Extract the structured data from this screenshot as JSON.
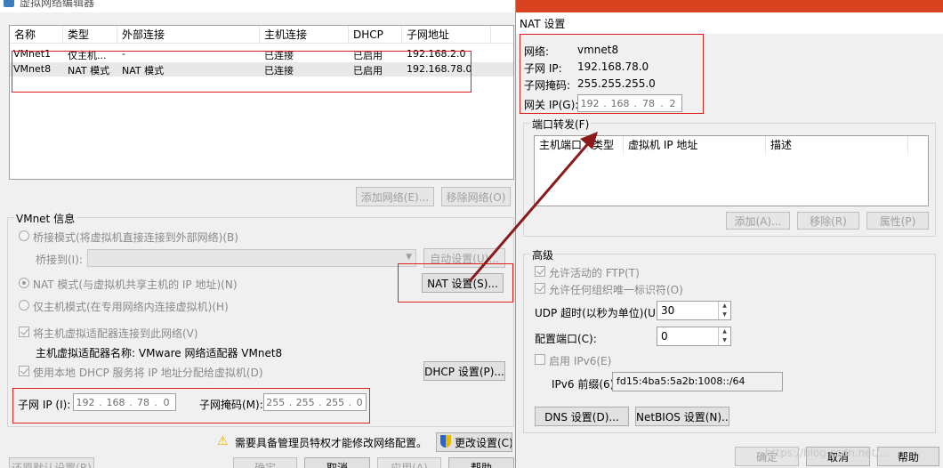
{
  "left": {
    "title": "虚拟网络编辑器",
    "columns": [
      "名称",
      "类型",
      "外部连接",
      "主机连接",
      "DHCP",
      "子网地址"
    ],
    "rows": [
      {
        "name": "VMnet1",
        "type": "仅主机...",
        "ext": "-",
        "host": "已连接",
        "dhcp": "已启用",
        "subnet": "192.168.2.0"
      },
      {
        "name": "VMnet8",
        "type": "NAT 模式",
        "ext": "NAT 模式",
        "host": "已连接",
        "dhcp": "已启用",
        "subnet": "192.168.78.0"
      }
    ],
    "add_network": "添加网络(E)...",
    "remove_network": "移除网络(O)",
    "info_title": "VMnet 信息",
    "bridge_mode": "桥接模式(将虚拟机直接连接到外部网络)(B)",
    "bridge_to": "桥接到(I):",
    "auto_settings": "自动设置(U)...",
    "nat_mode": "NAT 模式(与虚拟机共享主机的 IP 地址)(N)",
    "nat_settings": "NAT 设置(S)...",
    "host_only": "仅主机模式(在专用网络内连接虚拟机)(H)",
    "connect_adapter": "将主机虚拟适配器连接到此网络(V)",
    "adapter_name": "主机虚拟适配器名称: VMware 网络适配器 VMnet8",
    "use_dhcp": "使用本地 DHCP 服务将 IP 地址分配给虚拟机(D)",
    "dhcp_settings": "DHCP 设置(P)...",
    "subnet_ip_label": "子网 IP (I):",
    "subnet_ip": [
      "192",
      "168",
      "78",
      "0"
    ],
    "subnet_mask_label": "子网掩码(M):",
    "subnet_mask": [
      "255",
      "255",
      "255",
      "0"
    ],
    "admin_warning": "需要具备管理员特权才能修改网络配置。",
    "change_settings": "更改设置(C)",
    "restore_defaults": "还原默认设置(R)",
    "ok": "确定",
    "cancel": "取消",
    "apply": "应用(A)",
    "help": "帮助"
  },
  "right": {
    "title": "NAT 设置",
    "network_label": "网络:",
    "network_value": "vmnet8",
    "subnet_ip_label": "子网 IP:",
    "subnet_ip_value": "192.168.78.0",
    "subnet_mask_label": "子网掩码:",
    "subnet_mask_value": "255.255.255.0",
    "gateway_label": "网关 IP(G):",
    "gateway_ip": [
      "192",
      "168",
      "78",
      "2"
    ],
    "port_forward": "端口转发(F)",
    "pf_columns": [
      "主机端口",
      "类型",
      "虚拟机 IP 地址",
      "描述"
    ],
    "pf_add": "添加(A)...",
    "pf_remove": "移除(R)",
    "pf_props": "属性(P)",
    "advanced": "高级",
    "allow_ftp": "允许活动的 FTP(T)",
    "allow_oui": "允许任何组织唯一标识符(O)",
    "udp_timeout_label": "UDP 超时(以秒为单位)(U):",
    "udp_timeout": "30",
    "config_port_label": "配置端口(C):",
    "config_port": "0",
    "enable_ipv6": "启用 IPv6(E)",
    "ipv6_prefix_label": "IPv6 前缀(6):",
    "ipv6_prefix": "fd15:4ba5:5a2b:1008::/64",
    "dns_settings": "DNS 设置(D)...",
    "netbios_settings": "NetBIOS 设置(N)...",
    "ok": "确定",
    "cancel": "取消",
    "help": "帮助"
  },
  "watermark": "https://blog.csdn.net/..."
}
